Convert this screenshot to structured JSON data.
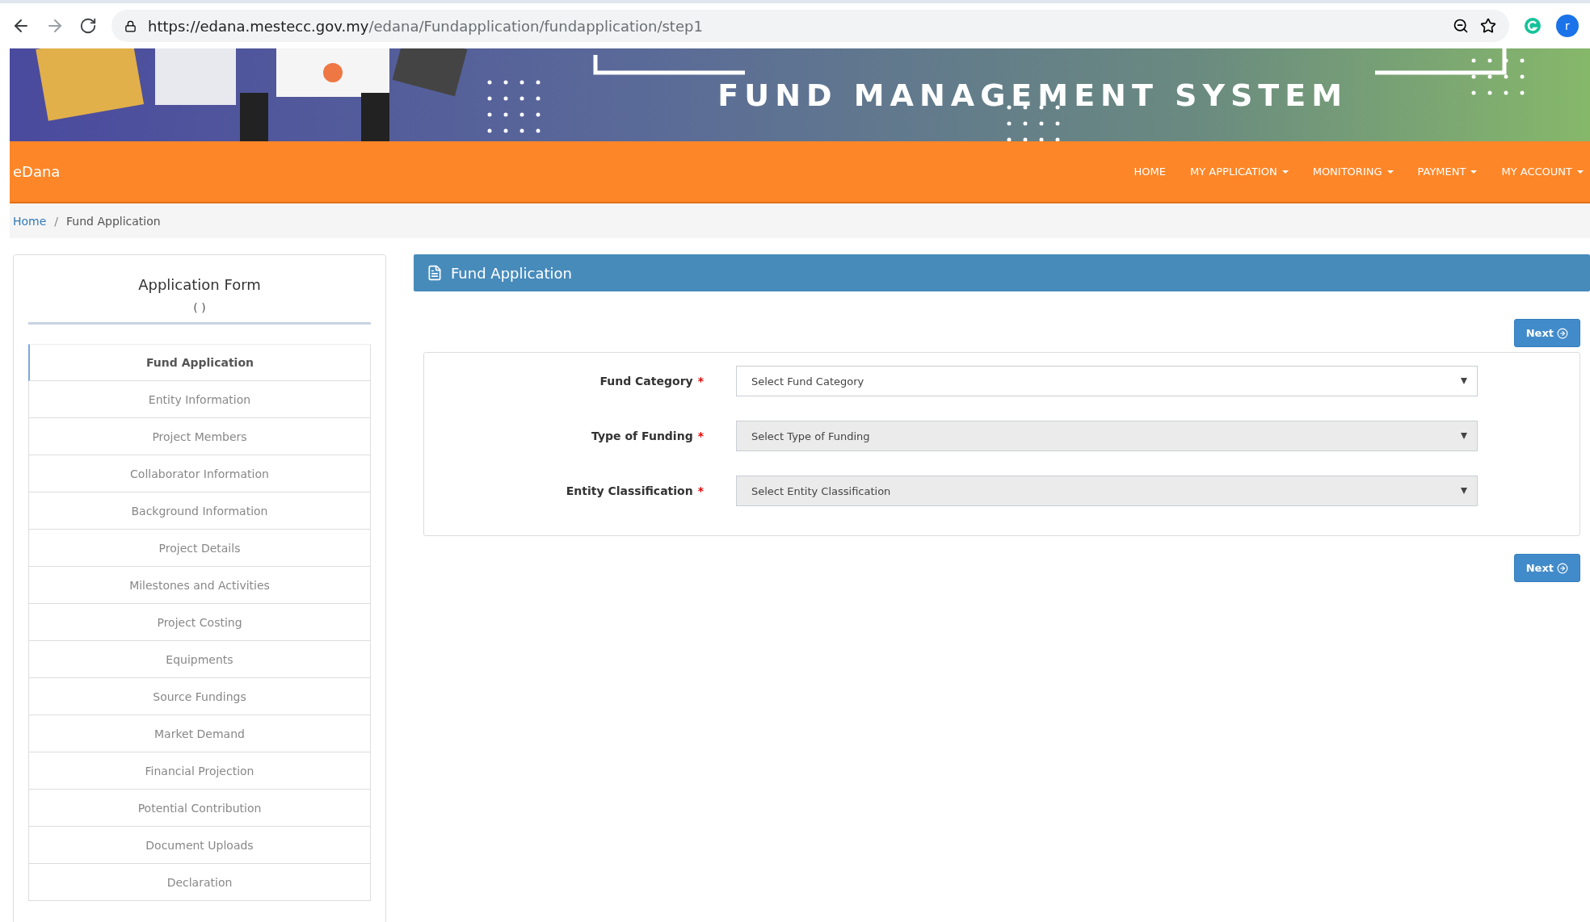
{
  "browser": {
    "url_host": "https://edana.mestecc.gov.my",
    "url_path": "/edana/Fundapplication/fundapplication/step1",
    "avatar": "r"
  },
  "banner": {
    "title": "FUND MANAGEMENT SYSTEM"
  },
  "navbar": {
    "brand": "eDana",
    "items": [
      {
        "label": "HOME",
        "dropdown": false
      },
      {
        "label": "MY APPLICATION",
        "dropdown": true
      },
      {
        "label": "MONITORING",
        "dropdown": true
      },
      {
        "label": "PAYMENT",
        "dropdown": true
      },
      {
        "label": "MY ACCOUNT",
        "dropdown": true
      }
    ]
  },
  "breadcrumb": [
    {
      "label": "Home",
      "link": true
    },
    {
      "separator": "/",
      "label": "Fund Application",
      "link": false
    }
  ],
  "sidebar": {
    "title": "Application Form",
    "subtitle": "( )",
    "items": [
      {
        "label": "Fund Application",
        "selected": true
      },
      {
        "label": "Entity Information",
        "selected": false
      },
      {
        "label": "Project Members",
        "selected": false
      },
      {
        "label": "Collaborator Information",
        "selected": false
      },
      {
        "label": "Background Information",
        "selected": false
      },
      {
        "label": "Project Details",
        "selected": false
      },
      {
        "label": "Milestones and Activities",
        "selected": false
      },
      {
        "label": "Project Costing",
        "selected": false
      },
      {
        "label": "Equipments",
        "selected": false
      },
      {
        "label": "Source Fundings",
        "selected": false
      },
      {
        "label": "Market Demand",
        "selected": false
      },
      {
        "label": "Financial Projection",
        "selected": false
      },
      {
        "label": "Potential Contribution",
        "selected": false
      },
      {
        "label": "Document Uploads",
        "selected": false
      },
      {
        "label": "Declaration",
        "selected": false
      }
    ]
  },
  "panel": {
    "title": "Fund Application",
    "next_top": "Next",
    "next_bottom": "Next",
    "fields": [
      {
        "label": "Fund Category",
        "required_mark": "*",
        "placeholder": "Select Fund Category",
        "disabled": false
      },
      {
        "label": "Type of Funding",
        "required_mark": "*",
        "placeholder": "Select Type of Funding",
        "disabled": true
      },
      {
        "label": "Entity Classification",
        "required_mark": "*",
        "placeholder": "Select Entity Classification",
        "disabled": true
      }
    ]
  }
}
